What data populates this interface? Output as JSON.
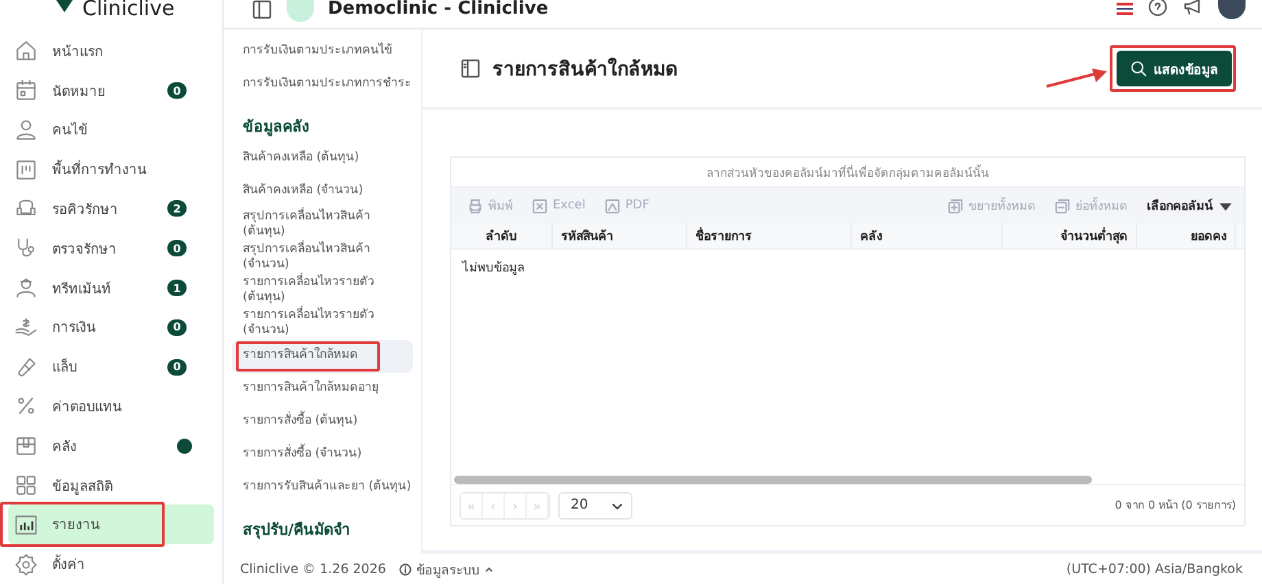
{
  "sidebar": {
    "logo": "Cliniclive",
    "items": [
      {
        "label": "หน้าแรก",
        "selected": false,
        "annotated": false
      },
      {
        "label": "นัดหมาย",
        "badge": "0",
        "selected": false,
        "annotated": false
      },
      {
        "label": "คนไข้",
        "selected": false,
        "annotated": false
      },
      {
        "label": "พื้นที่การทำงาน",
        "selected": false,
        "annotated": false
      },
      {
        "label": "รอคิวรักษา",
        "badge": "2",
        "selected": false,
        "annotated": false
      },
      {
        "label": "ตรวจรักษา",
        "badge": "0",
        "selected": false,
        "annotated": false
      },
      {
        "label": "ทรีทเม้นท์",
        "badge": "1",
        "selected": false,
        "annotated": false
      },
      {
        "label": "การเงิน",
        "badge": "0",
        "selected": false,
        "annotated": false
      },
      {
        "label": "แล็บ",
        "badge": "0",
        "selected": false,
        "annotated": false
      },
      {
        "label": "ค่าตอบแทน",
        "selected": false,
        "annotated": false
      },
      {
        "label": "คลัง",
        "dot": true,
        "selected": false,
        "annotated": false
      },
      {
        "label": "ข้อมูลสถิติ",
        "selected": false,
        "annotated": false
      },
      {
        "label": "รายงาน",
        "selected": true,
        "annotated": true
      },
      {
        "label": "ตั้งค่า",
        "selected": false,
        "annotated": false
      }
    ]
  },
  "header": {
    "title": "Democlinic - Cliniclive"
  },
  "report_menu": [
    {
      "kind": "link",
      "label": "การรับเงินตามประเภทคนไข้",
      "selected": false,
      "annotated": false
    },
    {
      "kind": "link",
      "label": "การรับเงินตามประเภทการชำระ",
      "selected": false,
      "annotated": false
    },
    {
      "kind": "heading",
      "label": "ข้อมูลคลัง"
    },
    {
      "kind": "link",
      "label": "สินค้าคงเหลือ (ต้นทุน)",
      "selected": false,
      "annotated": false
    },
    {
      "kind": "link",
      "label": "สินค้าคงเหลือ (จำนวน)",
      "selected": false,
      "annotated": false
    },
    {
      "kind": "link",
      "label": "สรุปการเคลื่อนไหวสินค้า (ต้นทุน)",
      "selected": false,
      "annotated": false
    },
    {
      "kind": "link",
      "label": "สรุปการเคลื่อนไหวสินค้า (จำนวน)",
      "selected": false,
      "annotated": false
    },
    {
      "kind": "link",
      "label": "รายการเคลื่อนไหวรายตัว (ต้นทุน)",
      "selected": false,
      "annotated": false
    },
    {
      "kind": "link",
      "label": "รายการเคลื่อนไหวรายตัว (จำนวน)",
      "selected": false,
      "annotated": false
    },
    {
      "kind": "link",
      "label": "รายการสินค้าใกล้หมด",
      "selected": true,
      "annotated": true
    },
    {
      "kind": "link",
      "label": "รายการสินค้าใกล้หมดอายุ",
      "selected": false,
      "annotated": false
    },
    {
      "kind": "link",
      "label": "รายการสั่งซื้อ (ต้นทุน)",
      "selected": false,
      "annotated": false
    },
    {
      "kind": "link",
      "label": "รายการสั่งซื้อ (จำนวน)",
      "selected": false,
      "annotated": false
    },
    {
      "kind": "link",
      "label": "รายการรับสินค้าและยา (ต้นทุน)",
      "selected": false,
      "annotated": false
    },
    {
      "kind": "heading",
      "label": "สรุปรับ/คืนมัดจำ"
    }
  ],
  "page": {
    "title": "รายการสินค้าใกล้หมด",
    "show_button": {
      "label": "แสดงข้อมูล",
      "annotated": true
    }
  },
  "grid": {
    "group_panel": "ลากส่วนหัวของคอลัมน์มาที่นี่เพื่อจัดกลุ่มตามคอลัมน์นั้น",
    "toolbar_left": [
      {
        "label": "พิมพ์",
        "disabled": true
      },
      {
        "label": "Excel",
        "disabled": true
      },
      {
        "label": "PDF",
        "disabled": true
      }
    ],
    "toolbar_right": [
      {
        "label": "ขยายทั้งหมด",
        "disabled": true
      },
      {
        "label": "ย่อทั้งหมด",
        "disabled": true
      }
    ],
    "column_chooser": "เลือกคอลัมน์",
    "columns": [
      "ลำดับ",
      "รหัสสินค้า",
      "ชื่อรายการ",
      "คลัง",
      "จำนวนต่ำสุด",
      "ยอดคง"
    ],
    "empty_text": "ไม่พบข้อมูล",
    "pager": {
      "buttons": [
        {
          "label": "«",
          "disabled": true
        },
        {
          "label": "‹",
          "disabled": true
        },
        {
          "label": "›",
          "disabled": true
        },
        {
          "label": "»",
          "disabled": true
        }
      ],
      "page_size": "20",
      "info": "0 จาก 0 หน้า (0 รายการ)"
    }
  },
  "footer": {
    "version": "Cliniclive © 1.26 2026",
    "system_info": "ข้อมูลระบบ",
    "timezone": "(UTC+07:00) Asia/Bangkok"
  }
}
